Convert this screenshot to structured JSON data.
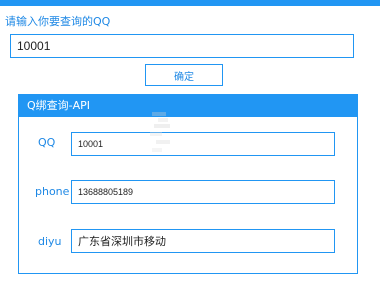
{
  "prompt_label": "请输入你要查询的QQ",
  "qq_input": {
    "value": "10001"
  },
  "confirm_button": "确定",
  "panel": {
    "title": "Q绑查询-API",
    "fields": [
      {
        "label": "QQ",
        "value": "10001"
      },
      {
        "label": "phone",
        "value": "13688805189"
      },
      {
        "label": "diyu",
        "value": "广东省深圳市移动"
      }
    ]
  },
  "colors": {
    "accent": "#2196f3",
    "label_text": "#1e88e5"
  }
}
